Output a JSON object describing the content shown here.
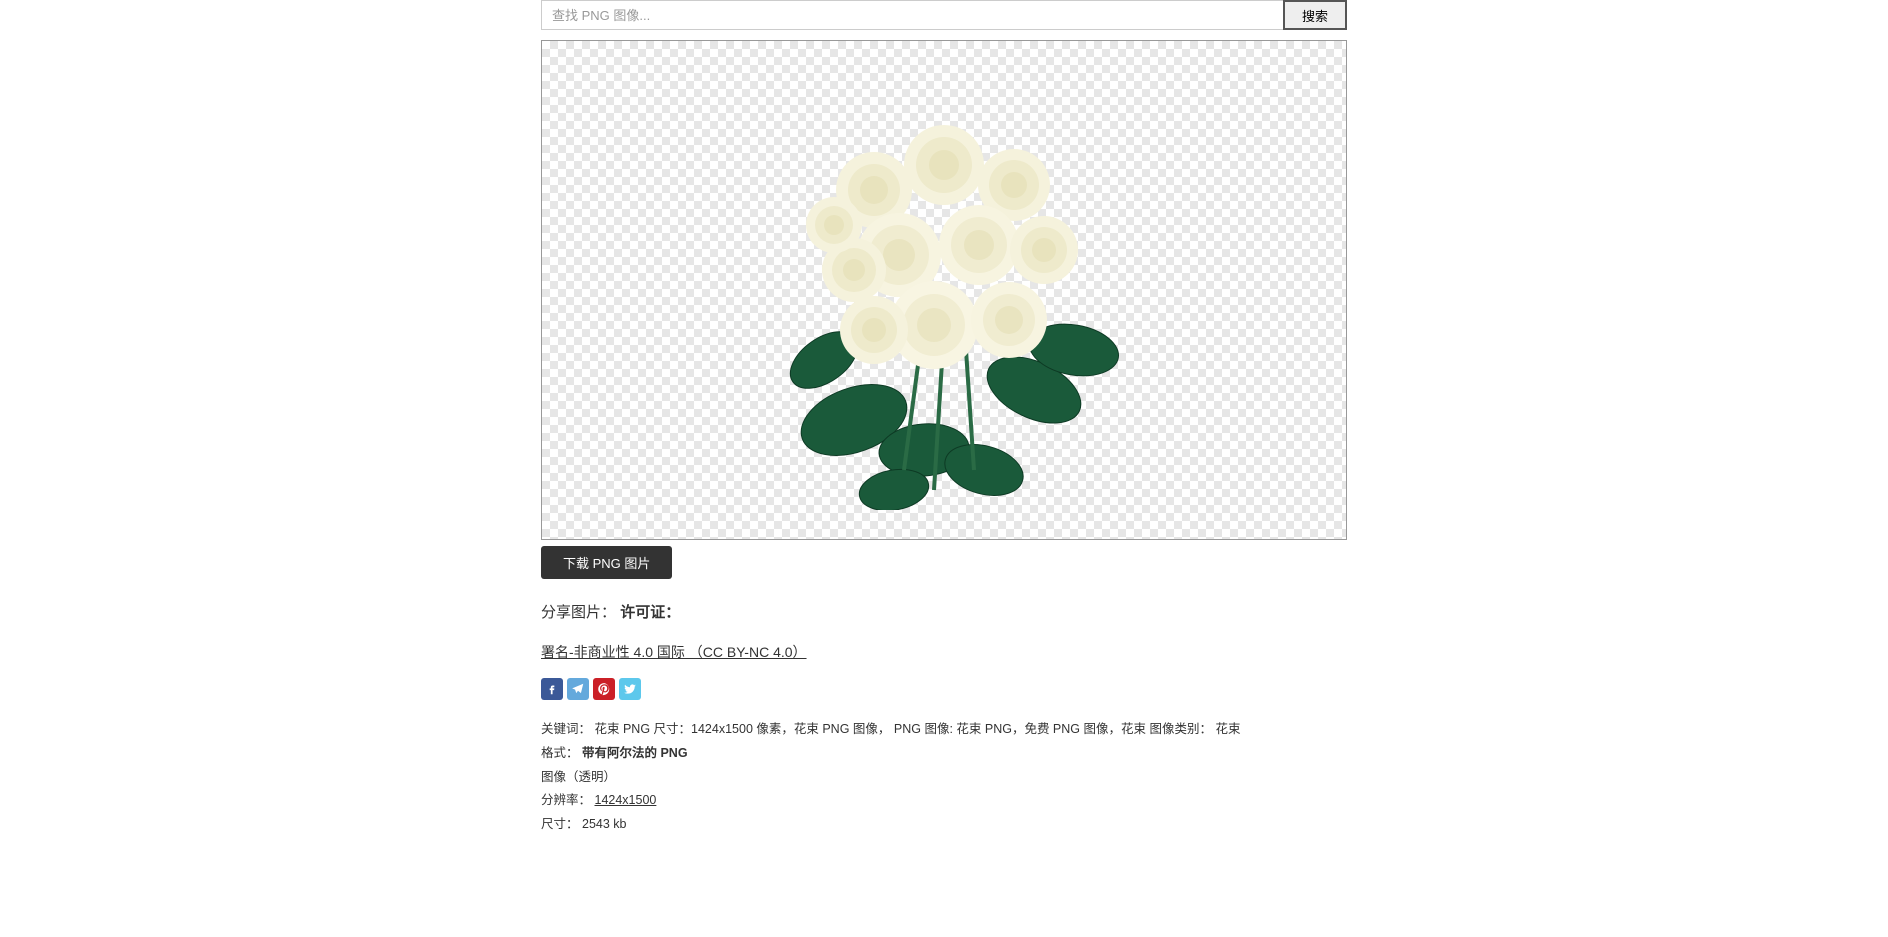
{
  "search": {
    "placeholder": "查找 PNG 图像...",
    "button": "搜索"
  },
  "download_button": "下载 PNG 图片",
  "share_license": {
    "share_label": "分享图片：",
    "license_title": "许可证："
  },
  "license_link": "署名-非商业性 4.0 国际 （CC BY-NC 4.0）",
  "social": {
    "fb": "facebook-icon",
    "tg": "telegram-icon",
    "pn": "pinterest-icon",
    "tw": "twitter-icon"
  },
  "meta": {
    "keywords_label": "关键词：",
    "keywords_value": "花束 PNG 尺寸：1424x1500 像素，花束 PNG 图像， PNG 图像: 花束 PNG，免费 PNG 图像，花束 图像类别： ",
    "category_link": "花束",
    "format_label": "格式：",
    "format_value": "带有阿尔法的 PNG",
    "image_type": "图像（透明）",
    "resolution_label": "分辨率：",
    "resolution_value": "1424x1500",
    "size_label": "尺寸：",
    "size_value": "2543 kb"
  }
}
